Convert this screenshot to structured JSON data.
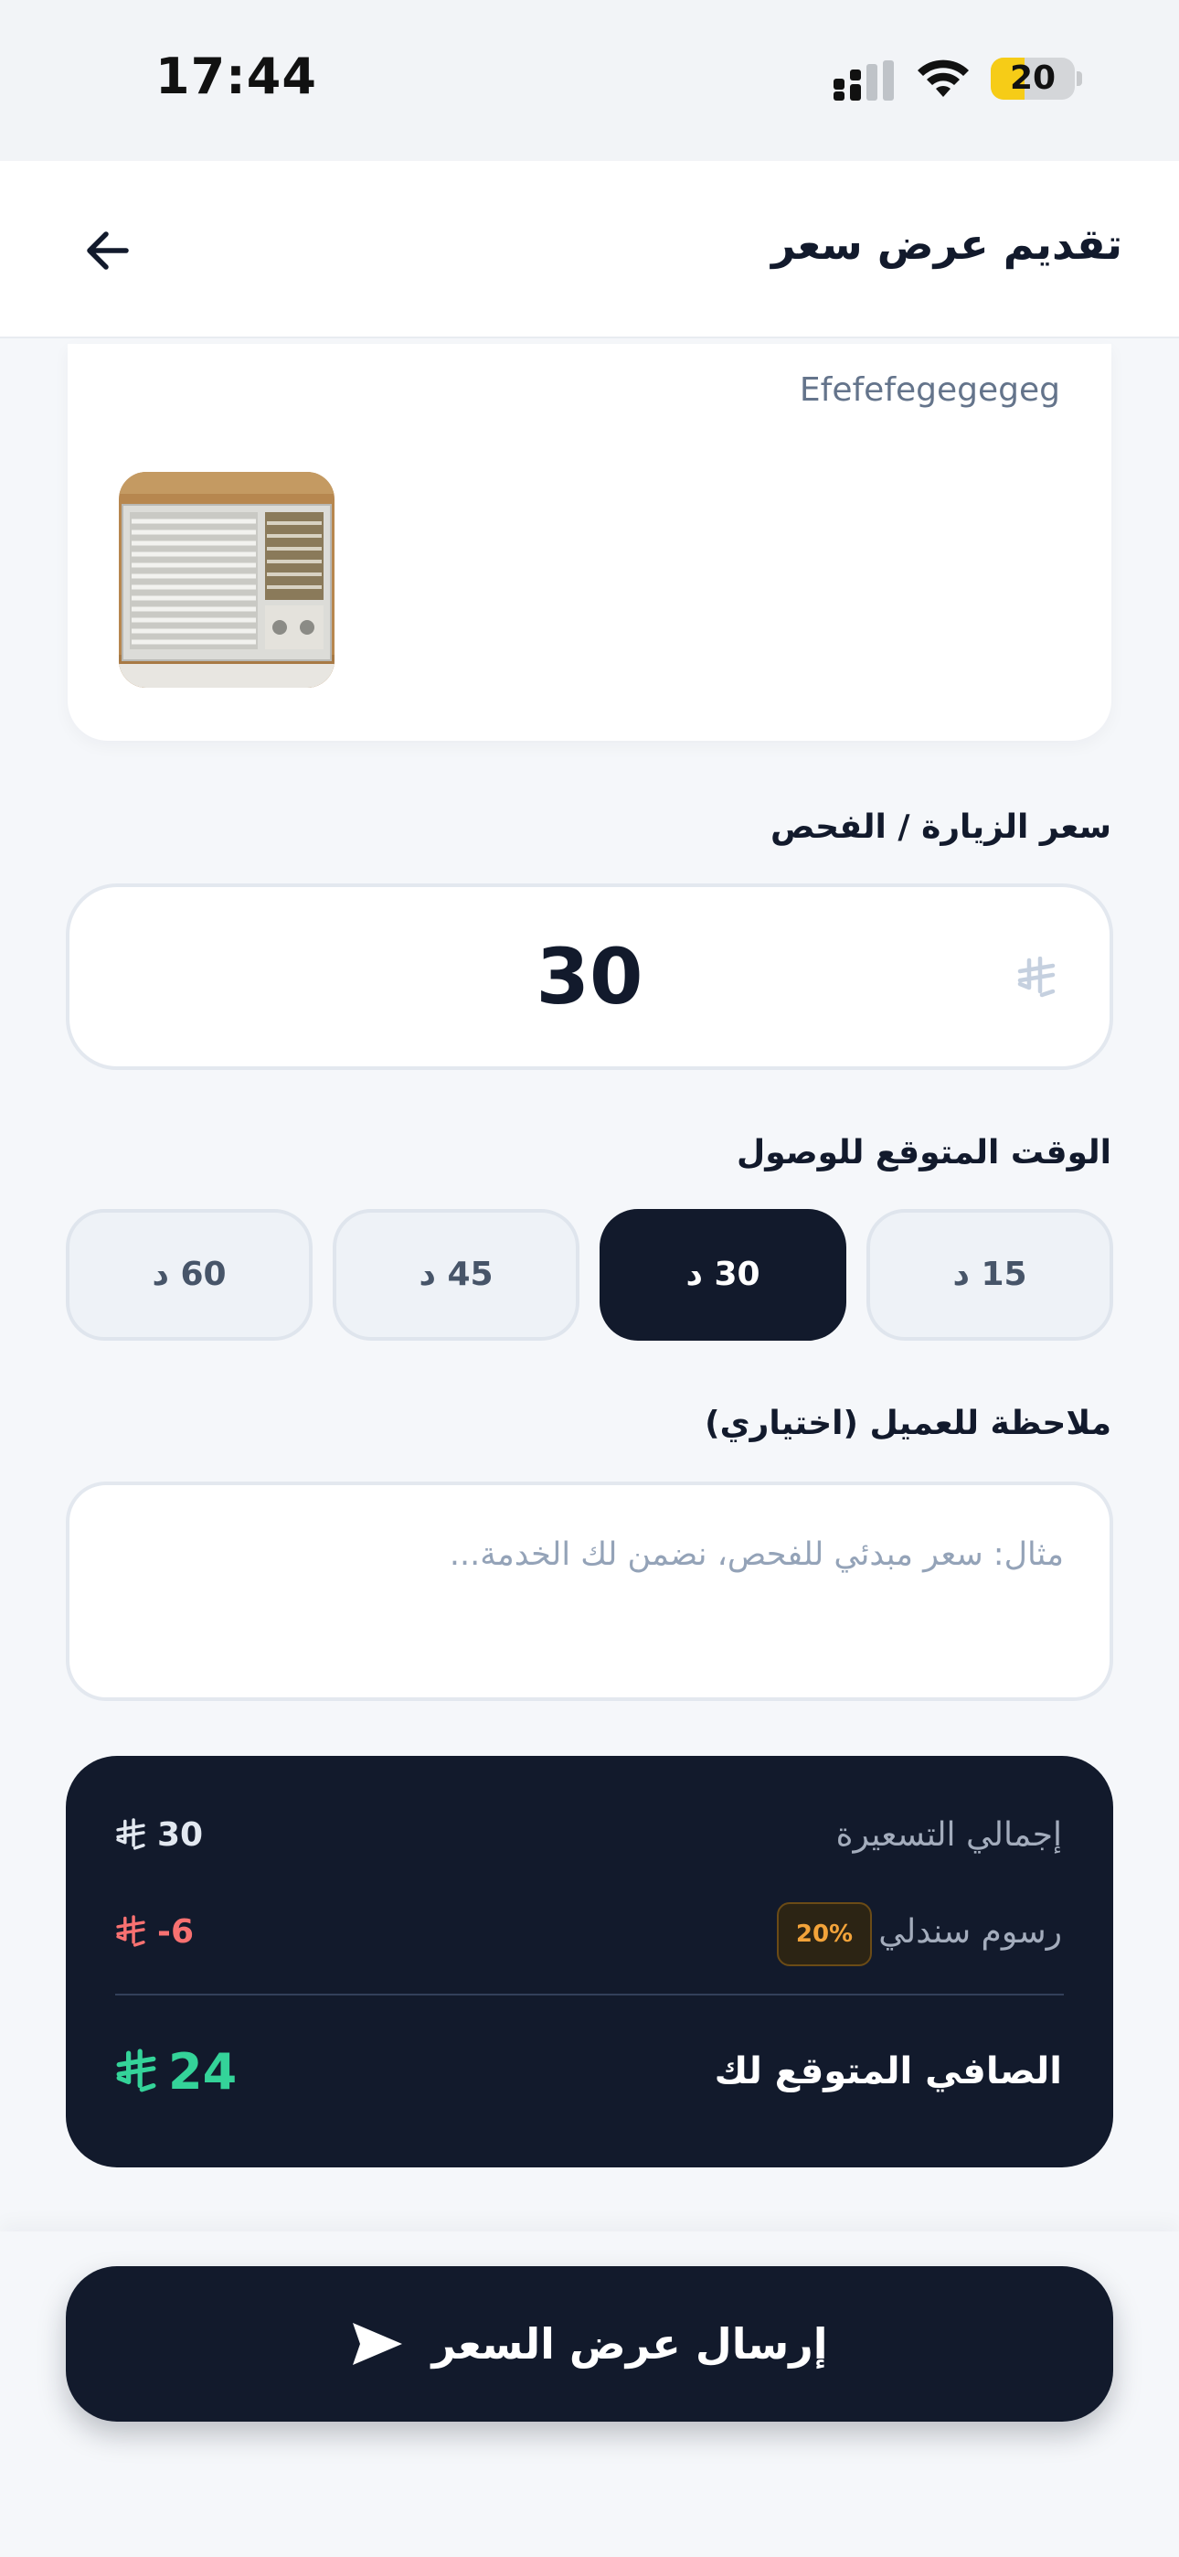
{
  "status_bar": {
    "time": "17:44",
    "battery_level": "20",
    "battery_color": "#f6cc17"
  },
  "header": {
    "title": "تقديم عرض سعر",
    "back_icon": "arrow-left-icon"
  },
  "request": {
    "description": "Efefefegegegeg",
    "photo": "air-conditioner-photo"
  },
  "visit_price": {
    "label": "سعر الزيارة / الفحص",
    "value": "30",
    "currency_icon": "saudi-riyal-icon"
  },
  "eta": {
    "label": "الوقت المتوقع للوصول",
    "options": [
      "15 د",
      "30 د",
      "45 د",
      "60 د"
    ],
    "selected": "30 د"
  },
  "note": {
    "label": "ملاحظة للعميل (اختياري)",
    "placeholder": "مثال: سعر مبدئي للفحص، نضمن لك الخدمة..."
  },
  "summary": {
    "total_label": "إجمالي التسعيرة",
    "total_value": "30",
    "fee_label": "رسوم سندلي",
    "fee_badge": "20%",
    "fee_value": "-6",
    "net_label": "الصافي المتوقع لك",
    "net_value": "24",
    "colors": {
      "fee": "#f87171",
      "net": "#34d399",
      "badge": "#f2a33a"
    }
  },
  "submit": {
    "label": "إرسال عرض السعر",
    "icon": "send-icon"
  }
}
